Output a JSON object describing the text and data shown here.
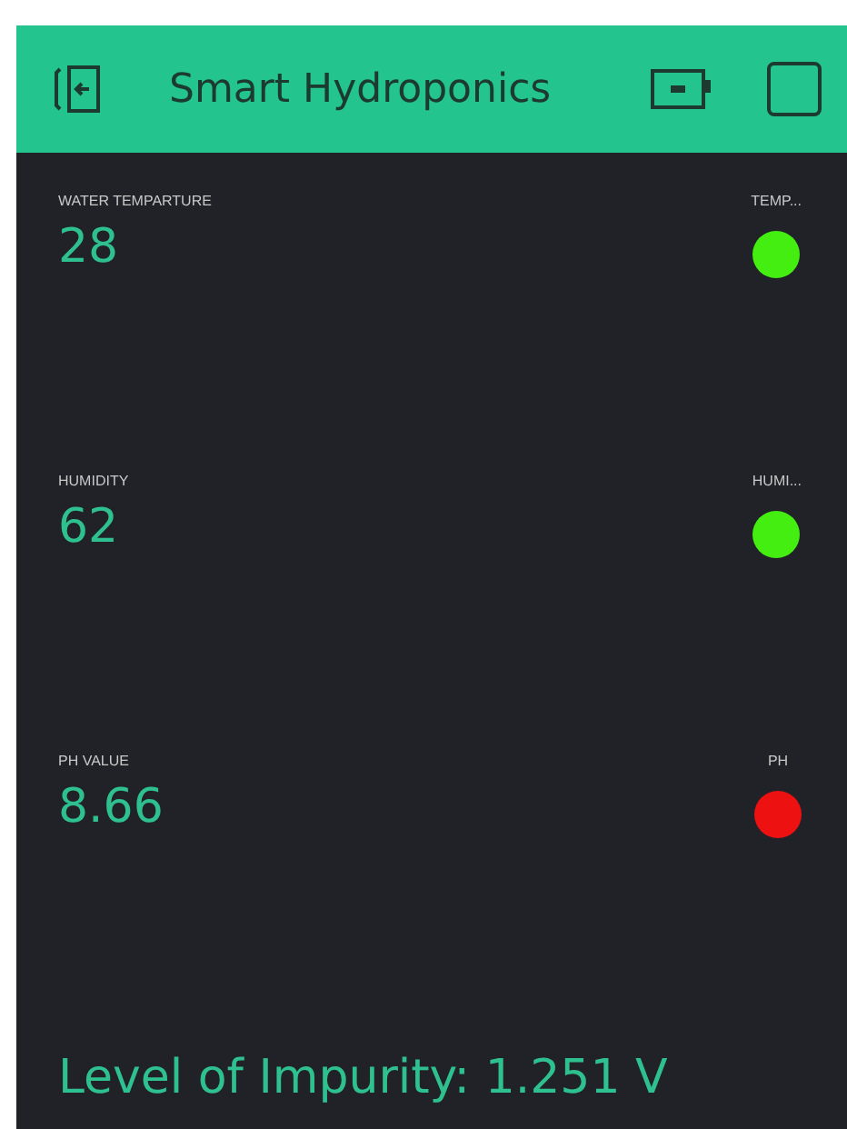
{
  "header": {
    "title": "Smart Hydroponics"
  },
  "widgets": [
    {
      "label": "WATER TEMPARTURE",
      "value": "28",
      "led_label": "TEMP...",
      "color": "#44ee11"
    },
    {
      "label": "HUMIDITY",
      "value": "62",
      "led_label": "HUMI...",
      "color": "#44ee11"
    },
    {
      "label": "PH VALUE",
      "value": "8.66",
      "led_label": "PH",
      "color": "#ee1111"
    }
  ],
  "impurity": {
    "text": "Level of Impurity: 1.251 V"
  }
}
